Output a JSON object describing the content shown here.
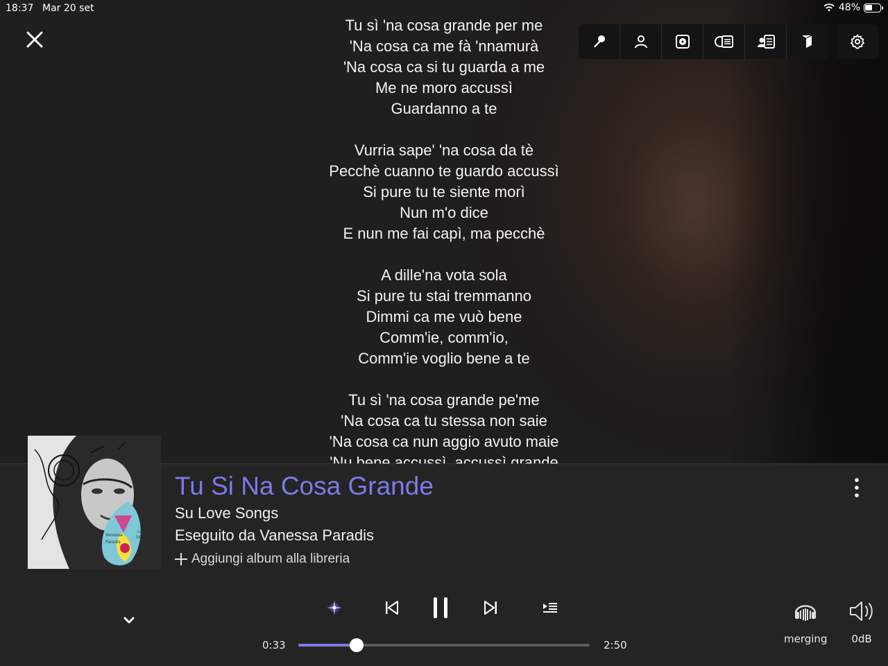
{
  "status_bar": {
    "time": "18:37",
    "date": "Mar 20 set",
    "battery_percent": "48%",
    "battery_level": 0.48
  },
  "lyrics": {
    "stanzas": [
      [
        "Tu sì 'na cosa grande per me",
        "'Na cosa ca me fà 'nnamurà",
        "'Na cosa ca si tu guarda a me",
        "Me ne moro accussì",
        "Guardanno a te"
      ],
      [
        "Vurria sape' 'na cosa da tè",
        "Pecchè cuanno te guardo accussì",
        "Si pure tu te siente morì",
        "Nun m'o dice",
        "E nun me fai capì, ma pecchè"
      ],
      [
        "A dille'na vota sola",
        "Si pure tu stai tremmanno",
        "Dimmi ca me vuò bene",
        "Comm'ie, comm'io,",
        "Comm'ie voglio bene a te"
      ],
      [
        "Tu sì 'na cosa grande pe'me",
        "'Na cosa ca tu stessa non saie",
        "'Na cosa ca nun aggio avuto maie",
        "'Nu bene accussì, accussì grande"
      ]
    ]
  },
  "toolbar": {
    "icons": [
      "lyrics-mic-icon",
      "artist-icon",
      "disc-icon",
      "credits-icon",
      "review-icon",
      "booklet-icon",
      "gear-icon"
    ]
  },
  "now_playing": {
    "title": "Tu Si Na Cosa Grande",
    "album_line": "Su Love Songs",
    "artist_line": "Eseguito da Vanessa Paradis",
    "add_album": "Aggiungi album alla libreria",
    "album_art_text": [
      "Vanessa",
      "Paradis",
      "Love",
      "Songs"
    ]
  },
  "playback": {
    "current_time": "0:33",
    "total_time": "2:50",
    "progress": 0.2,
    "device_label": "merging",
    "volume_label": "0dB"
  },
  "colors": {
    "accent": "#7b7be8",
    "panel": "#242424",
    "toolbar": "#141414"
  }
}
